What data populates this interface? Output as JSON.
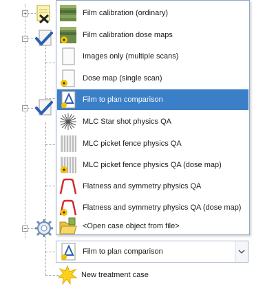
{
  "dropdown": {
    "items": [
      {
        "label": "Film calibration (ordinary)",
        "icon": "film-calibration-icon"
      },
      {
        "label": "Film calibration dose maps",
        "icon": "film-calibration-dose-icon"
      },
      {
        "label": "Images only (multiple scans)",
        "icon": "document-icon"
      },
      {
        "label": "Dose map (single scan)",
        "icon": "dose-map-icon"
      },
      {
        "label": "Film to plan comparison",
        "icon": "film-plan-comparison-icon",
        "selected": true
      },
      {
        "label": "MLC Star shot physics QA",
        "icon": "star-shot-icon"
      },
      {
        "label": "MLC picket fence physics QA",
        "icon": "picket-fence-icon"
      },
      {
        "label": "MLC picket fence physics QA (dose map)",
        "icon": "picket-fence-dose-icon"
      },
      {
        "label": "Flatness and symmetry physics QA",
        "icon": "flatness-symmetry-icon"
      },
      {
        "label": "Flatness and symmetry physics QA (dose map)",
        "icon": "flatness-symmetry-dose-icon"
      },
      {
        "label": "<Open case object from file>",
        "icon": "open-folder-icon"
      }
    ]
  },
  "combo": {
    "selected_label": "Film to plan comparison",
    "icon": "film-plan-comparison-icon"
  },
  "tree": {
    "new_case_label": "New treatment case"
  },
  "colors": {
    "selection": "#3a7fc8",
    "accent_blue": "#2a5fb0",
    "radiation_yellow": "#f2c200",
    "flatness_red": "#d22a2a"
  }
}
